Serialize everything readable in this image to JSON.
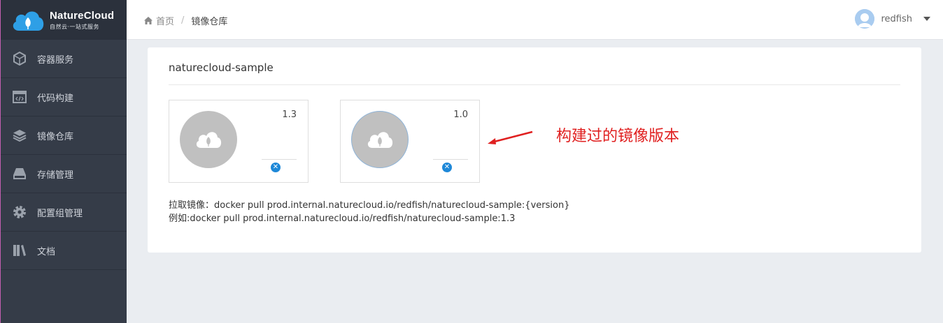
{
  "brand": {
    "name": "NatureCloud",
    "tagline": "自然云·一站式服务"
  },
  "sidebar": {
    "items": [
      {
        "label": "容器服务",
        "icon": "cube-icon"
      },
      {
        "label": "代码构建",
        "icon": "code-icon"
      },
      {
        "label": "镜像仓库",
        "icon": "layers-icon"
      },
      {
        "label": "存储管理",
        "icon": "drive-icon"
      },
      {
        "label": "配置组管理",
        "icon": "gear-icon"
      },
      {
        "label": "文档",
        "icon": "books-icon"
      }
    ]
  },
  "breadcrumb": {
    "home": "首页",
    "separator": "/",
    "current": "镜像仓库"
  },
  "user": {
    "name": "redfish"
  },
  "repo": {
    "title": "naturecloud-sample",
    "versions": [
      {
        "tag": "1.3"
      },
      {
        "tag": "1.0"
      }
    ],
    "pull_line": "拉取镜像：docker pull prod.internal.naturecloud.io/redfish/naturecloud-sample:{version}",
    "example_line": "例如:docker pull prod.internal.naturecloud.io/redfish/naturecloud-sample:1.3"
  },
  "annotation": {
    "text": "构建过的镜像版本",
    "color": "#e02020"
  },
  "colors": {
    "sidebar_bg": "#353c48",
    "logo_bg": "#2b313c",
    "accent": "#1e88d8",
    "page_bg": "#eaedf1"
  }
}
